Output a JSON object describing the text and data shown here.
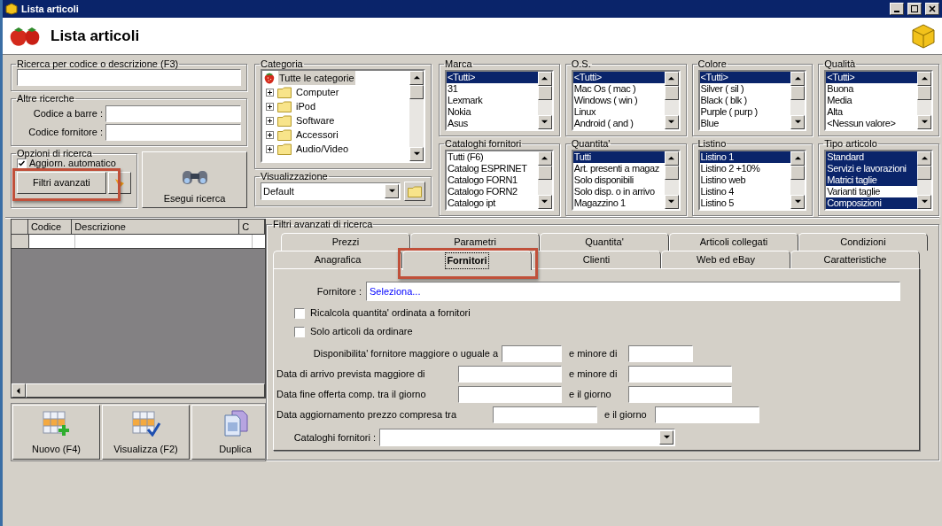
{
  "window": {
    "title": "Lista articoli"
  },
  "header": {
    "title": "Lista articoli"
  },
  "search": {
    "title": "Ricerca per codice o descrizione (F3)"
  },
  "other_search": {
    "title": "Altre ricerche",
    "fields": [
      {
        "label": "Codice a barre :"
      },
      {
        "label": "Codice fornitore :"
      }
    ]
  },
  "search_options": {
    "title": "Opzioni di ricerca",
    "auto_update": {
      "label": "Aggiorn. automatico",
      "checked": true
    },
    "advanced_button": {
      "label": "Filtri avanzati",
      "highlighted": true
    }
  },
  "run_button": "Esegui ricerca",
  "category": {
    "title": "Categoria",
    "tree": [
      {
        "label": "Tutte le categorie",
        "selected": true,
        "children": [
          {
            "label": "Computer",
            "expanded": false,
            "selected": false
          },
          {
            "label": "iPod",
            "expanded": false,
            "selected": false
          },
          {
            "label": "Software",
            "expanded": false,
            "selected": false
          },
          {
            "label": "Accessori",
            "expanded": false,
            "selected": false
          },
          {
            "label": "Audio/Video",
            "expanded": false,
            "selected": false
          }
        ]
      }
    ]
  },
  "view": {
    "title": "Visualizzazione",
    "value": "Default"
  },
  "lists": [
    {
      "title": "Marca",
      "items": [
        {
          "label": "<Tutti>",
          "selected": true
        },
        {
          "label": "31",
          "selected": false
        },
        {
          "label": "Lexmark",
          "selected": false
        },
        {
          "label": "Nokia",
          "selected": false
        },
        {
          "label": "Asus",
          "selected": false
        }
      ]
    },
    {
      "title": "O.S.",
      "items": [
        {
          "label": "<Tutti>",
          "selected": true
        },
        {
          "label": "Mac Os ( mac )",
          "selected": false
        },
        {
          "label": "Windows ( win )",
          "selected": false
        },
        {
          "label": "Linux",
          "selected": false
        },
        {
          "label": "Android ( and )",
          "selected": false
        }
      ]
    },
    {
      "title": "Colore",
      "items": [
        {
          "label": "<Tutti>",
          "selected": true
        },
        {
          "label": "Silver ( sil )",
          "selected": false
        },
        {
          "label": "Black ( blk )",
          "selected": false
        },
        {
          "label": "Purple ( purp )",
          "selected": false
        },
        {
          "label": "Blue",
          "selected": false
        }
      ]
    },
    {
      "title": "Qualità",
      "items": [
        {
          "label": "<Tutti>",
          "selected": true
        },
        {
          "label": "Buona",
          "selected": false
        },
        {
          "label": "Media",
          "selected": false
        },
        {
          "label": "Alta",
          "selected": false
        },
        {
          "label": "<Nessun valore>",
          "selected": false
        }
      ]
    },
    {
      "title": "Cataloghi fornitori",
      "items": [
        {
          "label": "Tutti (F6)",
          "selected": false
        },
        {
          "label": "Catalog ESPRINET",
          "selected": false
        },
        {
          "label": "Catalogo FORN1",
          "selected": false
        },
        {
          "label": "Catalogo FORN2",
          "selected": false
        },
        {
          "label": "Catalogo ipt",
          "selected": false
        }
      ]
    },
    {
      "title": "Quantita'",
      "items": [
        {
          "label": "Tutti",
          "selected": true
        },
        {
          "label": "Art. presenti a magaz",
          "selected": false
        },
        {
          "label": "Solo disponibili",
          "selected": false
        },
        {
          "label": "Solo disp. o in arrivo",
          "selected": false
        },
        {
          "label": "Magazzino 1",
          "selected": false
        }
      ]
    },
    {
      "title": "Listino",
      "items": [
        {
          "label": "Listino 1",
          "selected": true
        },
        {
          "label": "Listino 2 +10%",
          "selected": false
        },
        {
          "label": "Listino web",
          "selected": false
        },
        {
          "label": "Listino 4",
          "selected": false
        },
        {
          "label": "Listino 5",
          "selected": false
        }
      ]
    },
    {
      "title": "Tipo articolo",
      "items": [
        {
          "label": "Standard",
          "selected": true
        },
        {
          "label": "Servizi e lavorazioni",
          "selected": true
        },
        {
          "label": "Matrici taglie",
          "selected": true
        },
        {
          "label": "Varianti taglie",
          "selected": false
        },
        {
          "label": "Composizioni",
          "selected": true
        }
      ]
    }
  ],
  "grid": {
    "columns": [
      "Codice",
      "Descrizione",
      "C"
    ]
  },
  "buttons": [
    "Nuovo (F4)",
    "Visualizza (F2)",
    "Duplica"
  ],
  "filters": {
    "title": "Filtri avanzati di ricerca",
    "tabs_back": [
      {
        "label": "Prezzi",
        "selected": false,
        "highlighted": false
      },
      {
        "label": "Parametri",
        "selected": false,
        "highlighted": false
      },
      {
        "label": "Quantita'",
        "selected": false,
        "highlighted": false
      },
      {
        "label": "Articoli collegati",
        "selected": false,
        "highlighted": false
      },
      {
        "label": "Condizioni",
        "selected": false,
        "highlighted": false
      }
    ],
    "tabs_front": [
      {
        "label": "Anagrafica",
        "selected": false,
        "highlighted": false
      },
      {
        "label": "Fornitori",
        "selected": true,
        "highlighted": true
      },
      {
        "label": "Clienti",
        "selected": false,
        "highlighted": false
      },
      {
        "label": "Web ed eBay",
        "selected": false,
        "highlighted": false
      },
      {
        "label": "Caratteristiche",
        "selected": false,
        "highlighted": false
      }
    ],
    "supplier": {
      "label": "Fornitore :",
      "value": "Seleziona..."
    },
    "checkboxes": [
      {
        "label": "Ricalcola quantita' ordinata a fornitori",
        "checked": false
      },
      {
        "label": "Solo articoli da ordinare",
        "checked": false
      }
    ],
    "ranges": [
      {
        "label": "Disponibilita' fornitore maggiore o uguale a",
        "between_label": "e minore di"
      },
      {
        "label": "Data di arrivo prevista maggiore di",
        "between_label": "e minore di"
      },
      {
        "label": "Data fine offerta comp. tra il giorno",
        "between_label": "e il giorno"
      },
      {
        "label": "Data aggiornamento prezzo compresa tra",
        "between_label": "e il giorno"
      }
    ],
    "catalogs": {
      "label": "Cataloghi fornitori :"
    }
  }
}
